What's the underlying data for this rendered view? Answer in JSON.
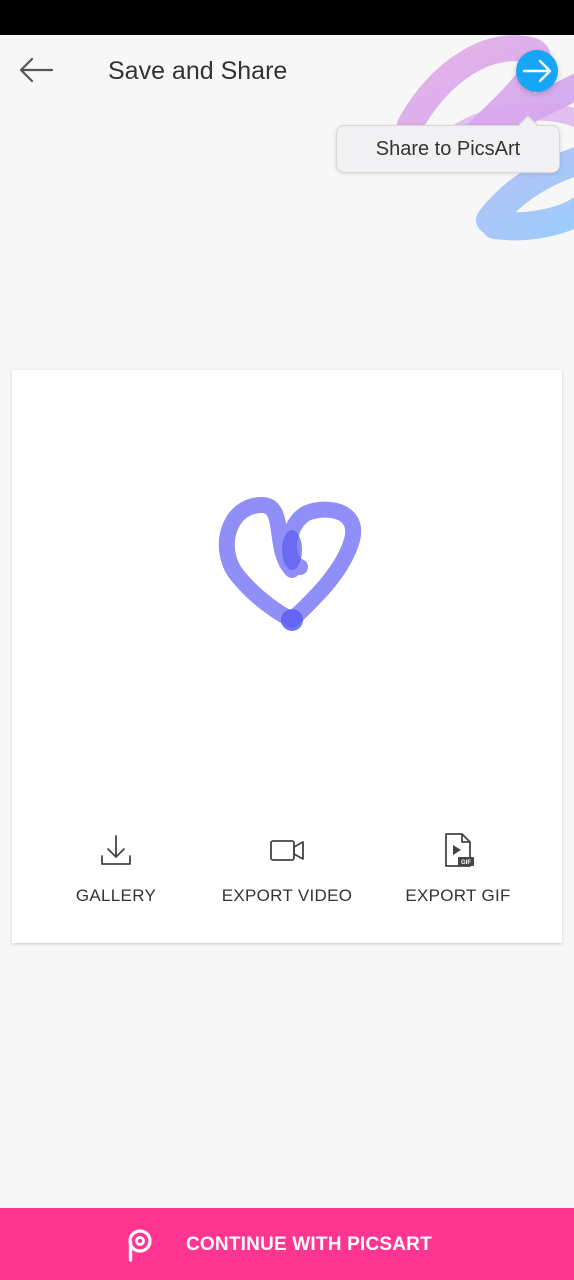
{
  "header": {
    "title": "Save and Share",
    "back_icon": "arrow-left-icon",
    "share_icon": "arrow-right-icon"
  },
  "tooltip": {
    "text": "Share to PicsArt"
  },
  "preview": {
    "description_icon": "heart-drawing",
    "stroke_color": "#7b7bf6"
  },
  "actions": [
    {
      "label": "GALLERY",
      "icon": "download-icon"
    },
    {
      "label": "EXPORT VIDEO",
      "icon": "video-camera-icon"
    },
    {
      "label": "EXPORT GIF",
      "icon": "gif-file-icon"
    }
  ],
  "bottom_bar": {
    "label": "CONTINUE WITH PICSART",
    "icon": "picsart-logo-icon",
    "color": "#ff3591"
  },
  "colors": {
    "accent_blue": "#16a6f5",
    "background": "#f7f7f7"
  }
}
